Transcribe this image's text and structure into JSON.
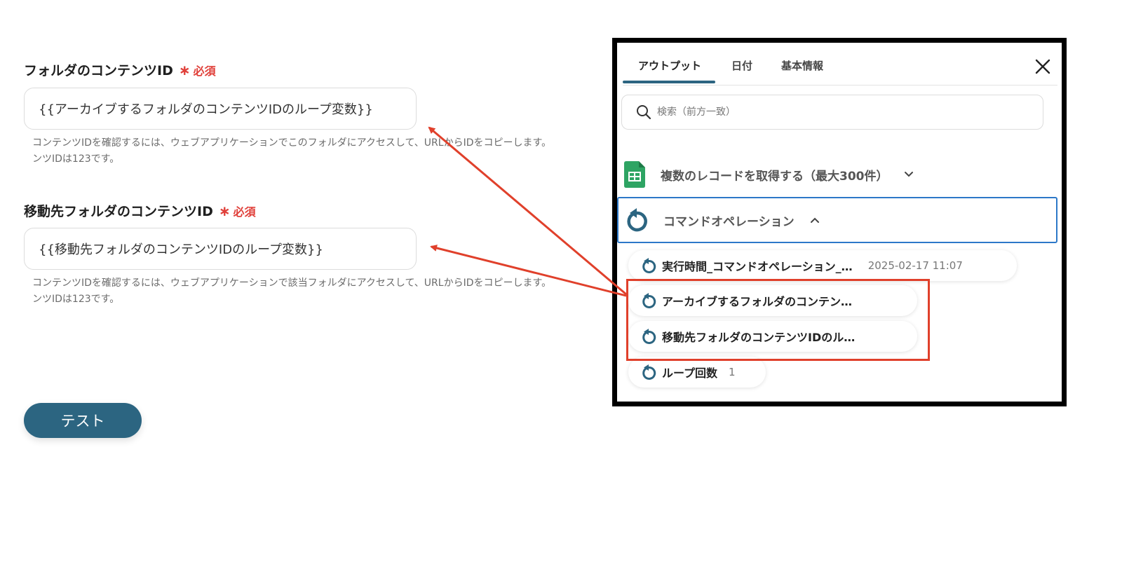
{
  "form": {
    "field1": {
      "label": "フォルダのコンテンツID",
      "required_star": "∗",
      "required_text": "必須",
      "value": "{{アーカイブするフォルダのコンテンツIDのループ変数}}",
      "help_line1": "コンテンツIDを確認するには、ウェブアプリケーションでこのフォルダにアクセスして、URLからIDをコピーします。",
      "help_line2": "ンツIDは123です。"
    },
    "field2": {
      "label": "移動先フォルダのコンテンツID",
      "required_star": "∗",
      "required_text": "必須",
      "value": "{{移動先フォルダのコンテンツIDのループ変数}}",
      "help_line1": "コンテンツIDを確認するには、ウェブアプリケーションで該当フォルダにアクセスして、URLからIDをコピーします。",
      "help_line2": "ンツIDは123です。"
    },
    "test_button": "テスト"
  },
  "panel": {
    "tabs": [
      {
        "label": "アウトプット",
        "active": true
      },
      {
        "label": "日付",
        "active": false
      },
      {
        "label": "基本情報",
        "active": false
      }
    ],
    "search_placeholder": "検索（前方一致）",
    "groups": [
      {
        "title": "複数のレコードを取得する（最大300件）",
        "icon": "spreadsheet-icon",
        "expanded": false
      },
      {
        "title": "コマンドオペレーション",
        "icon": "loop-icon",
        "expanded": true
      }
    ],
    "items": [
      {
        "title": "実行時間_コマンドオペレーション_…",
        "value": "2025-02-17 11:07",
        "icon": "loop-icon"
      },
      {
        "title": "アーカイブするフォルダのコンテン…",
        "value": "",
        "icon": "loop-icon"
      },
      {
        "title": "移動先フォルダのコンテンツIDのル…",
        "value": "",
        "icon": "loop-icon"
      },
      {
        "title": "ループ回数",
        "value": "1",
        "icon": "loop-icon"
      }
    ]
  },
  "colors": {
    "accent": "#2c6581",
    "required": "#e0403a",
    "annotation": "#e0402b",
    "selected_border": "#2c78c8",
    "sheet_green": "#2ea463"
  }
}
